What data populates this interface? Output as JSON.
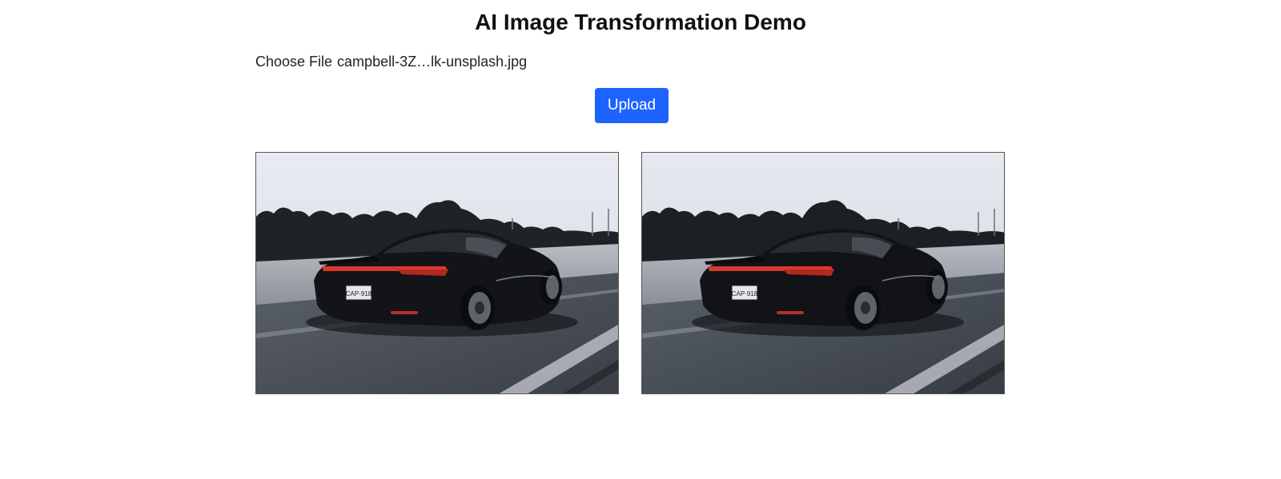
{
  "page": {
    "title": "AI Image Transformation Demo"
  },
  "file_input": {
    "button_label": "Choose File",
    "file_name": "campbell-3Z…lk-unsplash.jpg"
  },
  "upload": {
    "label": "Upload",
    "color": "#1c63ff"
  },
  "images": {
    "original": {
      "subject": "black sports car on highway",
      "plate_text": "CAP·918"
    },
    "transformed": {
      "subject": "black sports car on highway",
      "plate_text": "CAP·918"
    }
  }
}
